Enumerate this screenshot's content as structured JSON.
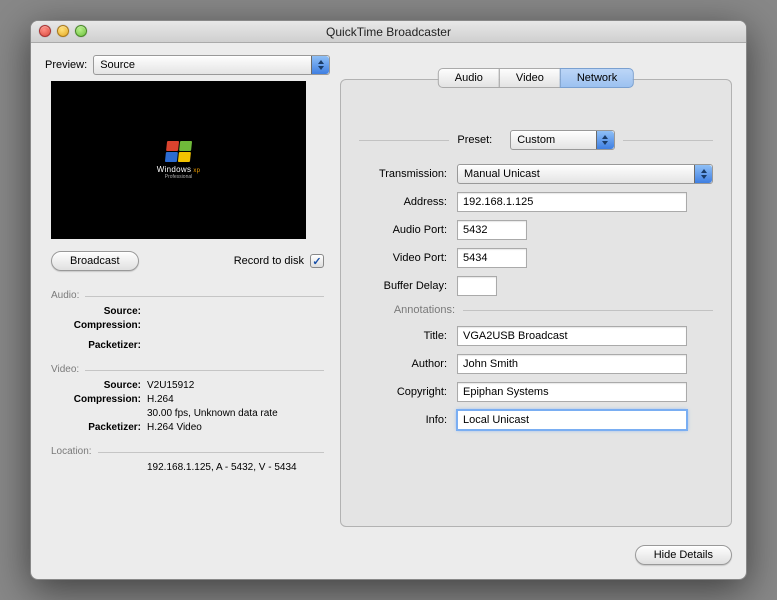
{
  "window": {
    "title": "QuickTime Broadcaster"
  },
  "left": {
    "preview_label": "Preview:",
    "preview_select_value": "Source",
    "broadcast_btn": "Broadcast",
    "record_label": "Record to disk",
    "preview_logo_text": "Windows",
    "preview_logo_sup": "xp",
    "preview_logo_sub": "Professional",
    "audio_header": "Audio:",
    "audio": {
      "source_k": "Source:",
      "source_v": "",
      "compression_k": "Compression:",
      "compression_v": "",
      "packetizer_k": "Packetizer:",
      "packetizer_v": ""
    },
    "video_header": "Video:",
    "video": {
      "source_k": "Source:",
      "source_v": "V2U15912",
      "compression_k": "Compression:",
      "compression_v": "H.264",
      "compression_v2": "30.00 fps, Unknown data rate",
      "packetizer_k": "Packetizer:",
      "packetizer_v": "H.264 Video"
    },
    "location_header": "Location:",
    "location_v": "192.168.1.125, A - 5432, V - 5434"
  },
  "tabs": {
    "audio": "Audio",
    "video": "Video",
    "network": "Network"
  },
  "right": {
    "preset_label": "Preset:",
    "preset_value": "Custom",
    "transmission_label": "Transmission:",
    "transmission_value": "Manual Unicast",
    "address_label": "Address:",
    "address_value": "192.168.1.125",
    "audioport_label": "Audio Port:",
    "audioport_value": "5432",
    "videoport_label": "Video Port:",
    "videoport_value": "5434",
    "bufdelay_label": "Buffer Delay:",
    "bufdelay_value": "",
    "annotations_label": "Annotations:",
    "title_label": "Title:",
    "title_value": "VGA2USB Broadcast",
    "author_label": "Author:",
    "author_value": "John Smith",
    "copyright_label": "Copyright:",
    "copyright_value": "Epiphan Systems",
    "info_label": "Info:",
    "info_value": "Local Unicast"
  },
  "footer": {
    "hide_details": "Hide Details"
  }
}
